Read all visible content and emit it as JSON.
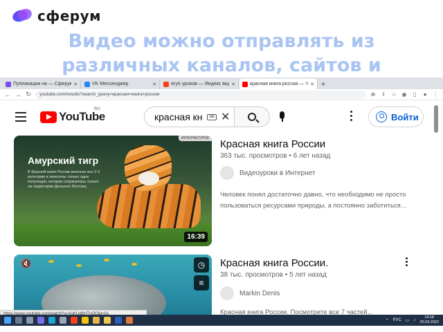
{
  "brand": {
    "name": "сферум"
  },
  "headline": [
    "Видео можно отправлять из",
    "различных каналов, сайтов и"
  ],
  "browser": {
    "tabs": [
      {
        "title": "Публикации на — Сферум",
        "color": "#7a4df0",
        "active": false
      },
      {
        "title": "VK Мессенджер",
        "color": "#2787f5",
        "active": false
      },
      {
        "title": "ягуб уроков — Яндекс видео",
        "color": "#fc3f1d",
        "active": false
      },
      {
        "title": "красная книга россии — YouTube",
        "color": "#ff0000",
        "active": true
      }
    ],
    "url": "youtube.com/results?search_query=красная+книга+россии"
  },
  "youtube": {
    "region": "RU",
    "logo_text": "YouTube",
    "search_value": "красная кн",
    "signin_label": "Войти"
  },
  "results": [
    {
      "title": "Красная книга России",
      "views": "363 тыс. просмотров",
      "age": "6 лет назад",
      "channel": "Видеоуроки в Интернет",
      "description": "Человек понял достаточно давно, что необходимо не просто пользоваться ресурсами природы, а постоянно заботиться…",
      "duration": "16:39",
      "thumb_title": "Амурский тигр",
      "thumb_desc": "В Красной книге России внесены все 2-3 категории и занесены только одна популяция, которая сохранилась только на территории Дальнего Востока.",
      "thumb_tag": "ИНТЕРНЕТУРОК"
    },
    {
      "title": "Красная книга России.",
      "views": "38 тыс. просмотров",
      "age": "5 лет назад",
      "channel": "Markin Denis",
      "description": "Красная книга России. Посмотрите все 7 частей..."
    }
  ],
  "status_url": "https://www.youtube.com/watch?v=XyKUd6HTnOQ&t=0s",
  "taskbar": {
    "lang": "РУС",
    "time": "14:18",
    "date": "20.03.2023"
  }
}
